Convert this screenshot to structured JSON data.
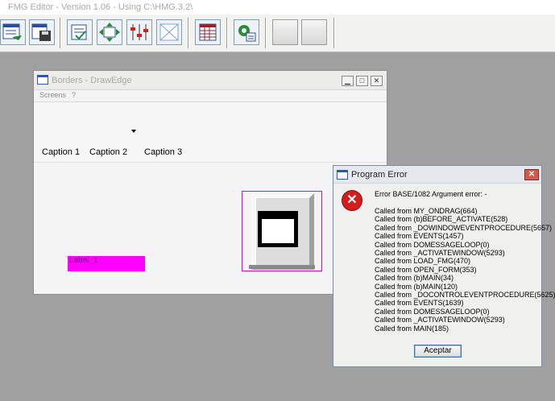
{
  "main_window": {
    "title": "FMG Editor - Version  1.06 - Using C:\\HMG.3.2\\"
  },
  "toolbar": {
    "buttons": [
      {
        "name": "open-form",
        "icon": "open-form-icon"
      },
      {
        "name": "save-form",
        "icon": "save-icon"
      },
      {
        "name": "properties",
        "icon": "properties-icon"
      },
      {
        "name": "move-controls",
        "icon": "move-icon"
      },
      {
        "name": "align",
        "icon": "align-icon",
        "label": "Align"
      },
      {
        "name": "clear",
        "icon": "clear-icon"
      },
      {
        "name": "grid",
        "icon": "grid-icon"
      },
      {
        "name": "settings",
        "icon": "settings-icon"
      },
      {
        "name": "blank-1",
        "icon": "blank-icon"
      },
      {
        "name": "blank-2",
        "icon": "blank-icon"
      }
    ]
  },
  "form_window": {
    "title": "Borders - DrawEdge",
    "menu": [
      "Screens",
      "?"
    ],
    "captions": [
      "Caption 1",
      "Caption 2",
      "Caption 3"
    ],
    "label": "Label_1",
    "colors": {
      "label_bg": "#ff00ff",
      "selection": "#e000e0"
    }
  },
  "error_dialog": {
    "title": "Program Error",
    "header": "Error BASE/1082  Argument error: -",
    "lines": [
      "Called from MY_ONDRAG(664)",
      "Called from (b)BEFORE_ACTIVATE(528)",
      "Called from _DOWINDOWEVENTPROCEDURE(5657)",
      "Called from EVENTS(1457)",
      "Called from DOMESSAGELOOP(0)",
      "Called from _ACTIVATEWINDOW(5293)",
      "Called from LOAD_FMG(470)",
      "Called from OPEN_FORM(353)",
      "Called from (b)MAIN(34)",
      "Called from (b)MAIN(120)",
      "Called from _DOCONTROLEVENTPROCEDURE(5625)",
      "Called from EVENTS(1639)",
      "Called from DOMESSAGELOOP(0)",
      "Called from _ACTIVATEWINDOW(5293)",
      "Called from MAIN(185)"
    ],
    "ok_label": "Aceptar",
    "colors": {
      "error_icon": "#d41e1e",
      "close_button": "#d45a48"
    }
  }
}
